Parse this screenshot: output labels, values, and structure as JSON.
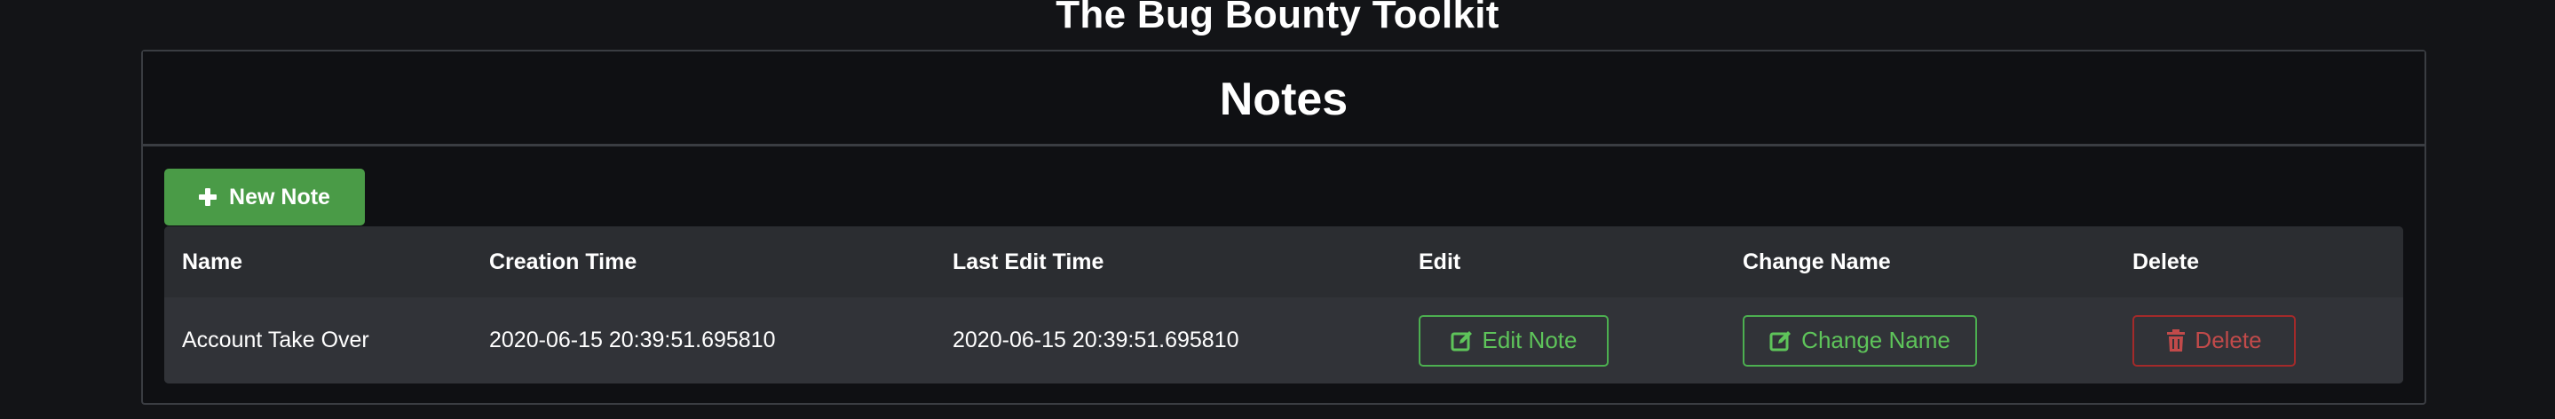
{
  "site": {
    "title": "The Bug Bounty Toolkit"
  },
  "notes_card": {
    "title": "Notes",
    "new_note_label": "New Note",
    "new_note_icon": "plus-icon"
  },
  "table": {
    "headers": {
      "name": "Name",
      "creation_time": "Creation Time",
      "last_edit_time": "Last Edit Time",
      "edit": "Edit",
      "change_name": "Change Name",
      "delete": "Delete"
    },
    "rows": [
      {
        "name": "Account Take Over",
        "creation_time": "2020-06-15 20:39:51.695810",
        "last_edit_time": "2020-06-15 20:39:51.695810",
        "edit_label": "Edit Note",
        "change_name_label": "Change Name",
        "delete_label": "Delete"
      }
    ]
  },
  "colors": {
    "background": "#131417",
    "card_border": "#3a3d42",
    "primary_green": "#4a9b47",
    "outline_green": "#5ec45a",
    "danger_red": "#c24a4a",
    "table_header_bg": "#2b2d31",
    "table_row_bg": "#313338"
  },
  "icons": {
    "edit": "edit-icon",
    "delete": "trash-icon"
  }
}
